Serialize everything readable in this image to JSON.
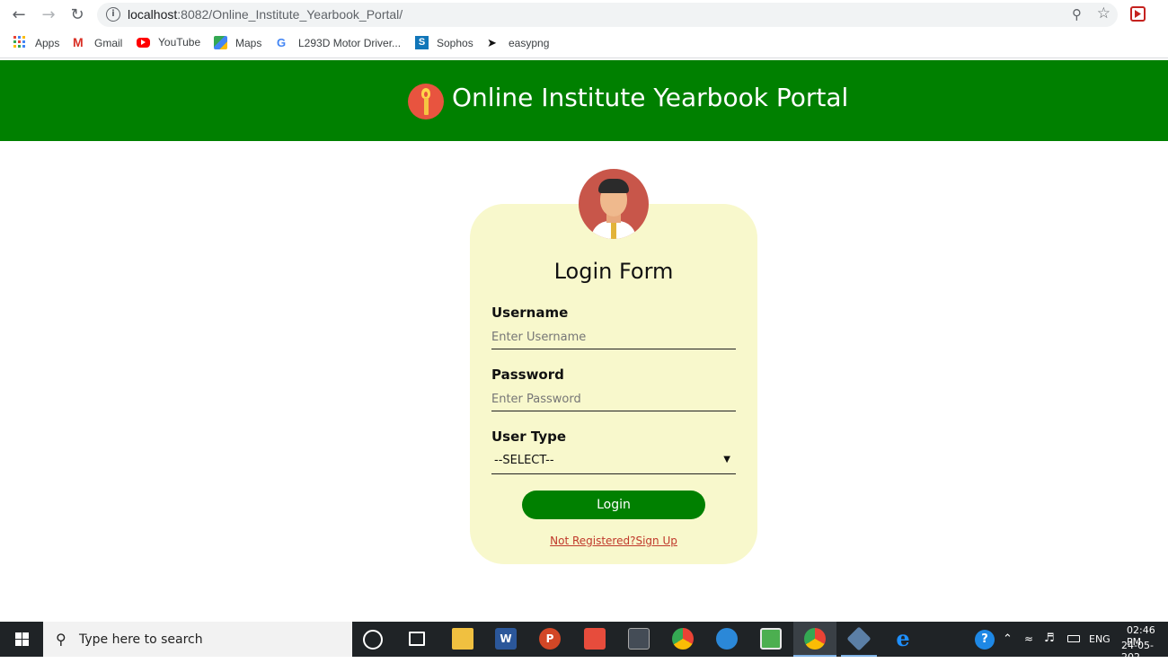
{
  "browser": {
    "url_host": "localhost",
    "url_rest": ":8082/Online_Institute_Yearbook_Portal/",
    "bookmarks": [
      {
        "label": "Apps"
      },
      {
        "label": "Gmail"
      },
      {
        "label": "YouTube"
      },
      {
        "label": "Maps"
      },
      {
        "label": "L293D Motor Driver..."
      },
      {
        "label": "Sophos"
      },
      {
        "label": "easypng"
      }
    ]
  },
  "header": {
    "title": "Online Institute Yearbook Portal"
  },
  "login": {
    "title": "Login Form",
    "username_label": "Username",
    "username_placeholder": "Enter Username",
    "password_label": "Password",
    "password_placeholder": "Enter Password",
    "usertype_label": "User Type",
    "usertype_selected": "--SELECT--",
    "login_button": "Login",
    "signup_link": "Not Registered?Sign Up"
  },
  "colors": {
    "header_bg": "#008000",
    "card_bg": "#f8f8cc",
    "button_bg": "#008000",
    "link": "#c0392b"
  },
  "taskbar": {
    "search_placeholder": "Type here to search",
    "language": "ENG",
    "time": "02:46 PM",
    "date": "24-05-202"
  }
}
